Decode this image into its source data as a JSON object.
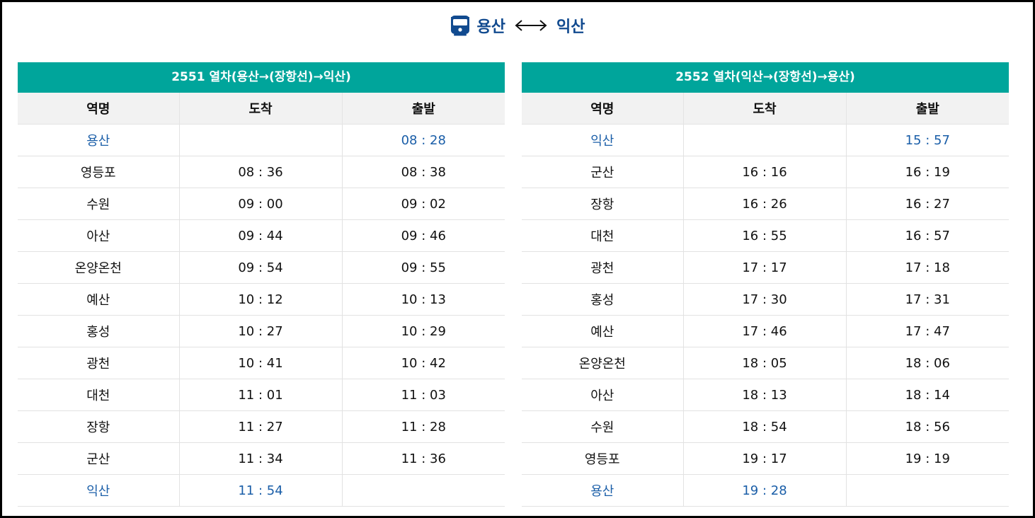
{
  "header": {
    "from": "용산",
    "to": "익산"
  },
  "tables": [
    {
      "caption": "2551 열차(용산→(장항선)→익산)",
      "columns": [
        "역명",
        "도착",
        "출발"
      ],
      "rows": [
        {
          "station": "용산",
          "arrive": "",
          "depart": "08 : 28"
        },
        {
          "station": "영등포",
          "arrive": "08 : 36",
          "depart": "08 : 38"
        },
        {
          "station": "수원",
          "arrive": "09 : 00",
          "depart": "09 : 02"
        },
        {
          "station": "아산",
          "arrive": "09 : 44",
          "depart": "09 : 46"
        },
        {
          "station": "온양온천",
          "arrive": "09 : 54",
          "depart": "09 : 55"
        },
        {
          "station": "예산",
          "arrive": "10 : 12",
          "depart": "10 : 13"
        },
        {
          "station": "홍성",
          "arrive": "10 : 27",
          "depart": "10 : 29"
        },
        {
          "station": "광천",
          "arrive": "10 : 41",
          "depart": "10 : 42"
        },
        {
          "station": "대천",
          "arrive": "11 : 01",
          "depart": "11 : 03"
        },
        {
          "station": "장항",
          "arrive": "11 : 27",
          "depart": "11 : 28"
        },
        {
          "station": "군산",
          "arrive": "11 : 34",
          "depart": "11 : 36"
        },
        {
          "station": "익산",
          "arrive": "11 : 54",
          "depart": ""
        }
      ]
    },
    {
      "caption": "2552 열차(익산→(장항선)→용산)",
      "columns": [
        "역명",
        "도착",
        "출발"
      ],
      "rows": [
        {
          "station": "익산",
          "arrive": "",
          "depart": "15 : 57"
        },
        {
          "station": "군산",
          "arrive": "16 : 16",
          "depart": "16 : 19"
        },
        {
          "station": "장항",
          "arrive": "16 : 26",
          "depart": "16 : 27"
        },
        {
          "station": "대천",
          "arrive": "16 : 55",
          "depart": "16 : 57"
        },
        {
          "station": "광천",
          "arrive": "17 : 17",
          "depart": "17 : 18"
        },
        {
          "station": "홍성",
          "arrive": "17 : 30",
          "depart": "17 : 31"
        },
        {
          "station": "예산",
          "arrive": "17 : 46",
          "depart": "17 : 47"
        },
        {
          "station": "온양온천",
          "arrive": "18 : 05",
          "depart": "18 : 06"
        },
        {
          "station": "아산",
          "arrive": "18 : 13",
          "depart": "18 : 14"
        },
        {
          "station": "수원",
          "arrive": "18 : 54",
          "depart": "18 : 56"
        },
        {
          "station": "영등포",
          "arrive": "19 : 17",
          "depart": "19 : 19"
        },
        {
          "station": "용산",
          "arrive": "19 : 28",
          "depart": ""
        }
      ]
    }
  ],
  "icons": {
    "title": "train-icon",
    "between": "double-arrow-icon"
  },
  "colors": {
    "header_bar": "#00a59b",
    "title_text": "#114a8f",
    "terminal_text": "#1a5ea8",
    "column_header_bg": "#f2f2f2"
  }
}
